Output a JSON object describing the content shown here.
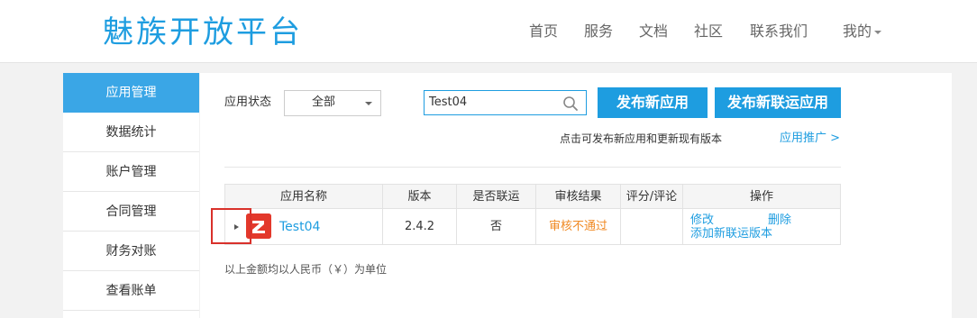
{
  "header": {
    "logo": "魅族开放平台",
    "nav": [
      {
        "label": "首页"
      },
      {
        "label": "服务"
      },
      {
        "label": "文档"
      },
      {
        "label": "社区"
      },
      {
        "label": "联系我们"
      },
      {
        "label": "我的"
      }
    ]
  },
  "sidebar": {
    "items": [
      {
        "label": "应用管理",
        "active": true
      },
      {
        "label": "数据统计"
      },
      {
        "label": "账户管理"
      },
      {
        "label": "合同管理"
      },
      {
        "label": "财务对账"
      },
      {
        "label": "查看账单"
      }
    ]
  },
  "filter": {
    "status_label": "应用状态",
    "status_value": "全部",
    "search_value": "Test04"
  },
  "actions": {
    "publish_app": "发布新应用",
    "publish_joint_app": "发布新联运应用",
    "hint": "点击可发布新应用和更新现有版本",
    "promo_link": "应用推广 >"
  },
  "table": {
    "headers": [
      "应用名称",
      "版本",
      "是否联运",
      "审核结果",
      "评分/评论",
      "操作"
    ],
    "rows": [
      {
        "name": "Test04",
        "version": "2.4.2",
        "joint": "否",
        "review": "审核不通过",
        "rating": "",
        "ops": {
          "edit": "修改",
          "delete": "删除",
          "add_joint": "添加新联运版本"
        }
      }
    ]
  },
  "footnote": "以上金额均以人民币（￥）为单位",
  "colors": {
    "brand": "#1e9de0",
    "sidebar_active": "#3aa6e6",
    "review_fail": "#f08a24",
    "highlight_box": "#d9312b",
    "app_icon": "#e3382b"
  },
  "icons": {
    "search": "search-icon",
    "dropdown": "chevron-down-icon",
    "expand": "caret-right-icon",
    "app": "app-icon"
  }
}
